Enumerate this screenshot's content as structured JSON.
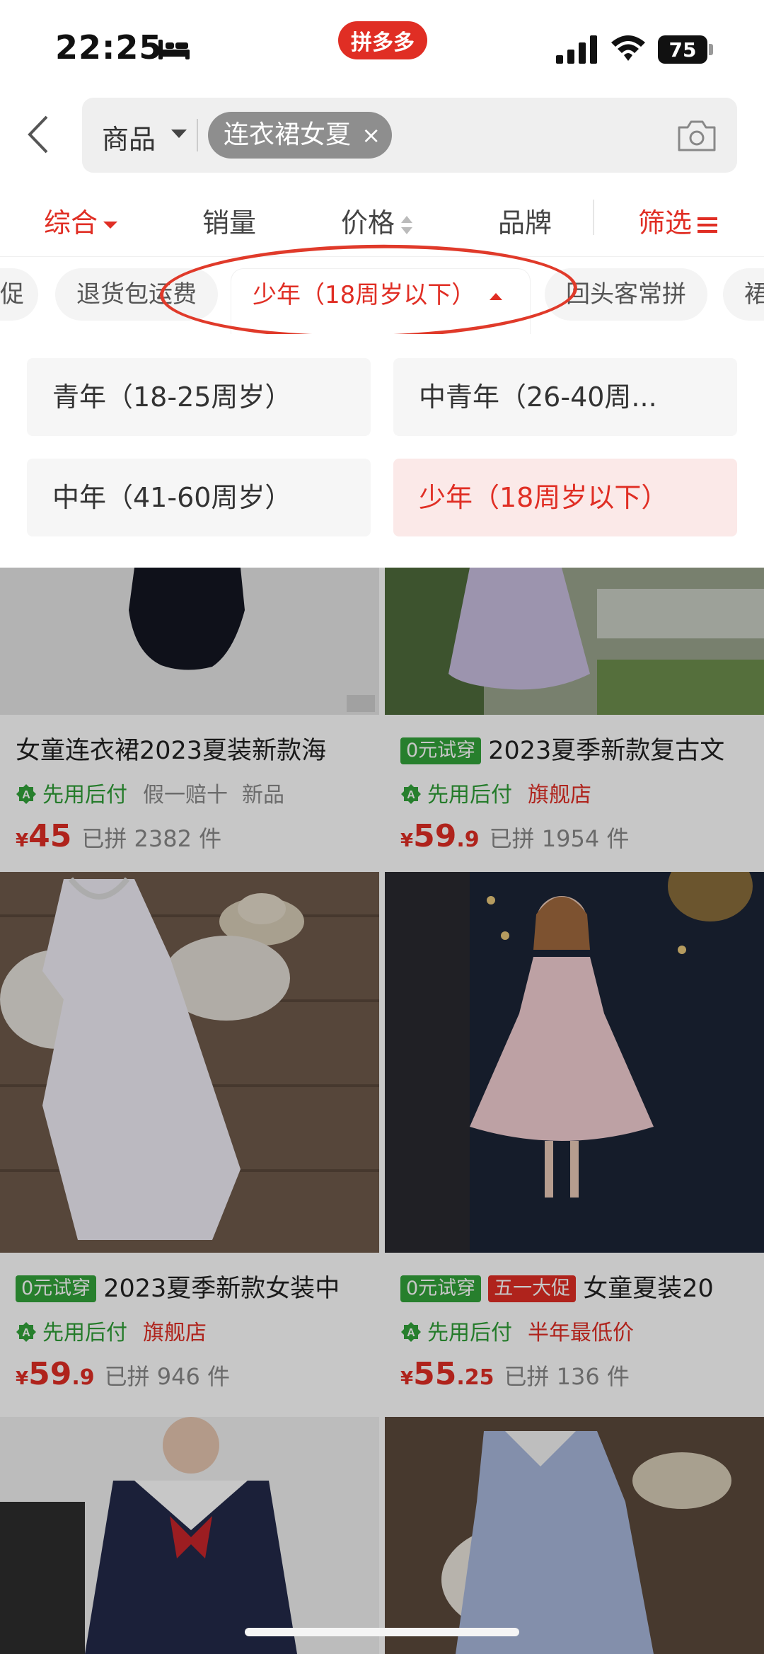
{
  "status_bar": {
    "time": "22:25",
    "app_label": "拼多多",
    "battery": "75"
  },
  "search": {
    "scope": "商品",
    "query_chip": "连衣裙女夏",
    "chip_close": "×"
  },
  "sort": {
    "comprehensive": "综合",
    "sales": "销量",
    "price": "价格",
    "brand": "品牌",
    "filter": "筛选"
  },
  "tags": [
    {
      "label": "促"
    },
    {
      "label": "退货包运费"
    },
    {
      "label": "少年（18周岁以下）",
      "active": true
    },
    {
      "label": "回头客常拼"
    },
    {
      "label": "裙"
    }
  ],
  "age_options": [
    {
      "label": "青年（18-25周岁）"
    },
    {
      "label": "中青年（26-40周..."
    },
    {
      "label": "中年（41-60周岁）"
    },
    {
      "label": "少年（18周岁以下）",
      "selected": true
    }
  ],
  "products": [
    {
      "badges": [],
      "title": "女童连衣裙2023夏装新款海",
      "pay": "先用后付",
      "tag1": "假一赔十",
      "tag2": "新品",
      "yen": "¥",
      "price_int": "45",
      "price_dec": "",
      "sold": "已拼 2382 件"
    },
    {
      "badges": [
        "0元试穿"
      ],
      "title": "2023夏季新款复古文",
      "pay": "先用后付",
      "tag1": "旗舰店",
      "tag2": "",
      "yen": "¥",
      "price_int": "59",
      "price_dec": ".9",
      "sold": "已拼 1954 件"
    },
    {
      "badges": [
        "0元试穿"
      ],
      "title": "2023夏季新款女装中",
      "pay": "先用后付",
      "tag1": "旗舰店",
      "tag2": "",
      "yen": "¥",
      "price_int": "59",
      "price_dec": ".9",
      "sold": "已拼 946 件"
    },
    {
      "badges": [
        "0元试穿",
        "五一大促"
      ],
      "title": "女童夏装20",
      "pay": "先用后付",
      "tag1": "半年最低价",
      "tag2": "",
      "yen": "¥",
      "price_int": "55",
      "price_dec": ".25",
      "sold": "已拼 136 件"
    }
  ],
  "colors": {
    "accent": "#e02e24",
    "pay_green": "#2f9e36"
  }
}
